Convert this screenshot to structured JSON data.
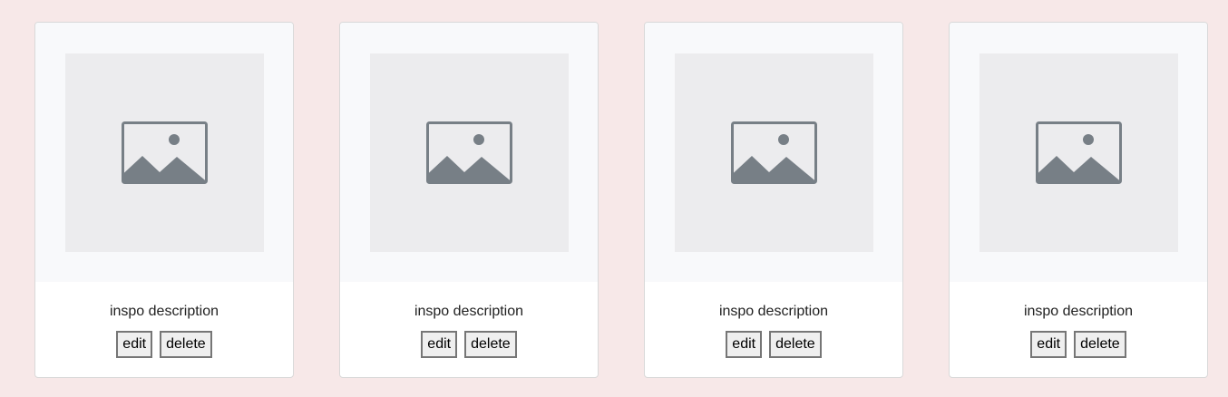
{
  "colors": {
    "page_background": "#f7e8e8",
    "card_background": "#ffffff",
    "image_area_background": "#f8f9fb",
    "placeholder_background": "#ececee",
    "icon_color": "#777f86"
  },
  "cards": [
    {
      "icon": "image-placeholder-icon",
      "description": "inspo description",
      "edit_label": "edit",
      "delete_label": "delete"
    },
    {
      "icon": "image-placeholder-icon",
      "description": "inspo description",
      "edit_label": "edit",
      "delete_label": "delete"
    },
    {
      "icon": "image-placeholder-icon",
      "description": "inspo description",
      "edit_label": "edit",
      "delete_label": "delete"
    },
    {
      "icon": "image-placeholder-icon",
      "description": "inspo description",
      "edit_label": "edit",
      "delete_label": "delete"
    }
  ]
}
